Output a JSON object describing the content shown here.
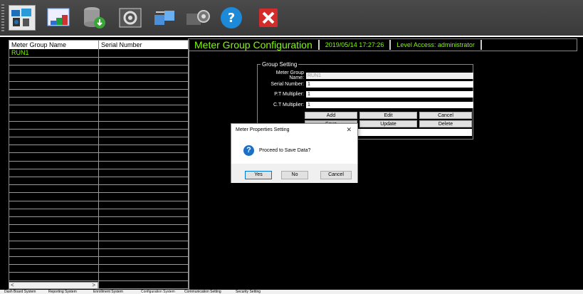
{
  "toolbar": {
    "items": [
      {
        "icon": "dashboard-icon",
        "selected": true
      },
      {
        "icon": "reports-icon",
        "selected": false
      },
      {
        "icon": "database-download-icon",
        "selected": false
      },
      {
        "icon": "settings-panel-icon",
        "selected": false
      },
      {
        "icon": "network-connection-icon",
        "selected": false
      },
      {
        "icon": "security-lock-icon",
        "selected": false
      },
      {
        "icon": "help-icon",
        "selected": false
      },
      {
        "icon": "close-icon",
        "selected": false
      }
    ]
  },
  "grid": {
    "columns": [
      "Meter Group Name",
      "Serial Number"
    ],
    "rows": [
      [
        "RUN1",
        ""
      ]
    ]
  },
  "header": {
    "title": "Meter Group Configuration",
    "datetime": "2019/05/14 17:27:26",
    "access": "Level Access:  administrator"
  },
  "group": {
    "legend": "Group Setting",
    "fields": [
      {
        "label": "Meter Group Name:",
        "value": "RUN1",
        "disabled": true
      },
      {
        "label": "Serial Number:",
        "value": "1",
        "disabled": false
      },
      {
        "label": "P.T Multiplier:",
        "value": "1",
        "disabled": false
      },
      {
        "label": "C.T Multiplier:",
        "value": "1",
        "disabled": false
      }
    ],
    "buttons_row1": [
      "Add",
      "Edit",
      "Cancel"
    ],
    "buttons_row2": [
      "Save",
      "Update",
      "Delete"
    ]
  },
  "dialog": {
    "title": "Meter Properties Setting",
    "close": "✕",
    "message": "Proceed to Save Data?",
    "buttons": [
      "Yes",
      "No",
      "Cancel"
    ]
  },
  "tabs": [
    {
      "label": "Dash Board System",
      "selected": false
    },
    {
      "label": "Reporting System",
      "selected": false
    },
    {
      "label": "Enrollment System",
      "selected": false
    },
    {
      "label": "Configuration System",
      "selected": true
    },
    {
      "label": "Communication Setting",
      "selected": false
    },
    {
      "label": "Security Setting",
      "selected": false
    }
  ],
  "colors": {
    "accent": "#7cfc00",
    "background": "#000000"
  }
}
